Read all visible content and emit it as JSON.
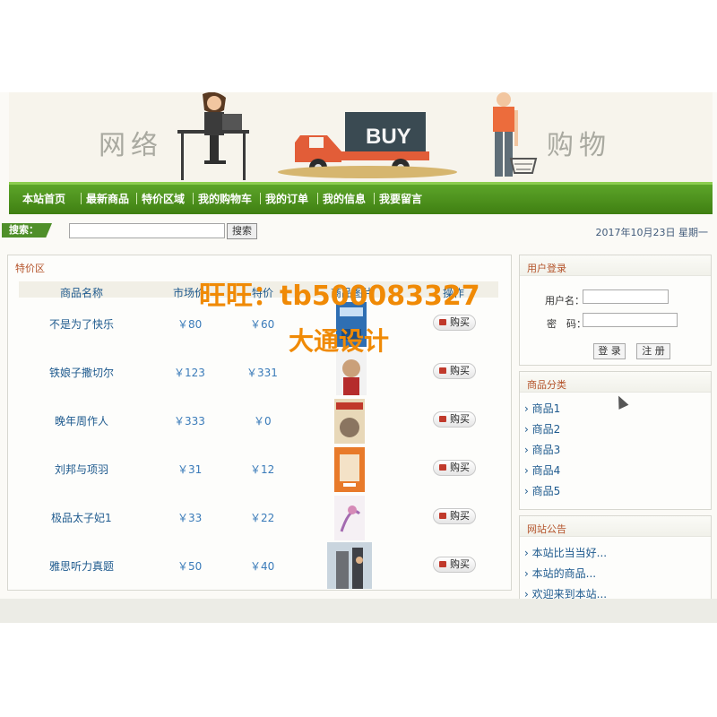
{
  "banner": {
    "left_text": "网络",
    "right_text": "购物",
    "truck_text": "BUY"
  },
  "nav": {
    "items": [
      "本站首页",
      "最新商品",
      "特价区域",
      "我的购物车",
      "我的订单",
      "我的信息",
      "我要留言"
    ]
  },
  "search": {
    "label": "搜索：",
    "value": "",
    "button": "搜索"
  },
  "date": "2017年10月23日 星期一",
  "special": {
    "title": "特价区",
    "headers": [
      "商品名称",
      "市场价",
      "特价",
      "商品图片",
      "操作"
    ],
    "rows": [
      {
        "name": "不是为了快乐",
        "market": "￥80",
        "special": "￥60",
        "action": "购买"
      },
      {
        "name": "铁娘子撒切尔",
        "market": "￥123",
        "special": "￥331",
        "action": "购买"
      },
      {
        "name": "晚年周作人",
        "market": "￥333",
        "special": "￥0",
        "action": "购买"
      },
      {
        "name": "刘邦与项羽",
        "market": "￥31",
        "special": "￥12",
        "action": "购买"
      },
      {
        "name": "极品太子妃1",
        "market": "￥33",
        "special": "￥22",
        "action": "购买"
      },
      {
        "name": "雅思听力真题",
        "market": "￥50",
        "special": "￥40",
        "action": "购买"
      }
    ]
  },
  "login": {
    "title": "用户登录",
    "username_label": "用户名：",
    "password_label": "密　码：",
    "login_button": "登 录",
    "register_button": "注 册"
  },
  "categories": {
    "title": "商品分类",
    "items": [
      "商品1",
      "商品2",
      "商品3",
      "商品4",
      "商品5"
    ]
  },
  "notice": {
    "title": "网站公告",
    "items": [
      "本站比当当好...",
      "本站的商品...",
      "欢迎来到本站..."
    ]
  },
  "watermark": {
    "line1": "旺旺：tb500083327",
    "line2": "大通设计"
  },
  "colors": {
    "nav_green": "#4f8f1f",
    "link_blue": "#1e5a8e",
    "title_orange": "#b4532a",
    "watermark_orange": "#f08a05"
  }
}
